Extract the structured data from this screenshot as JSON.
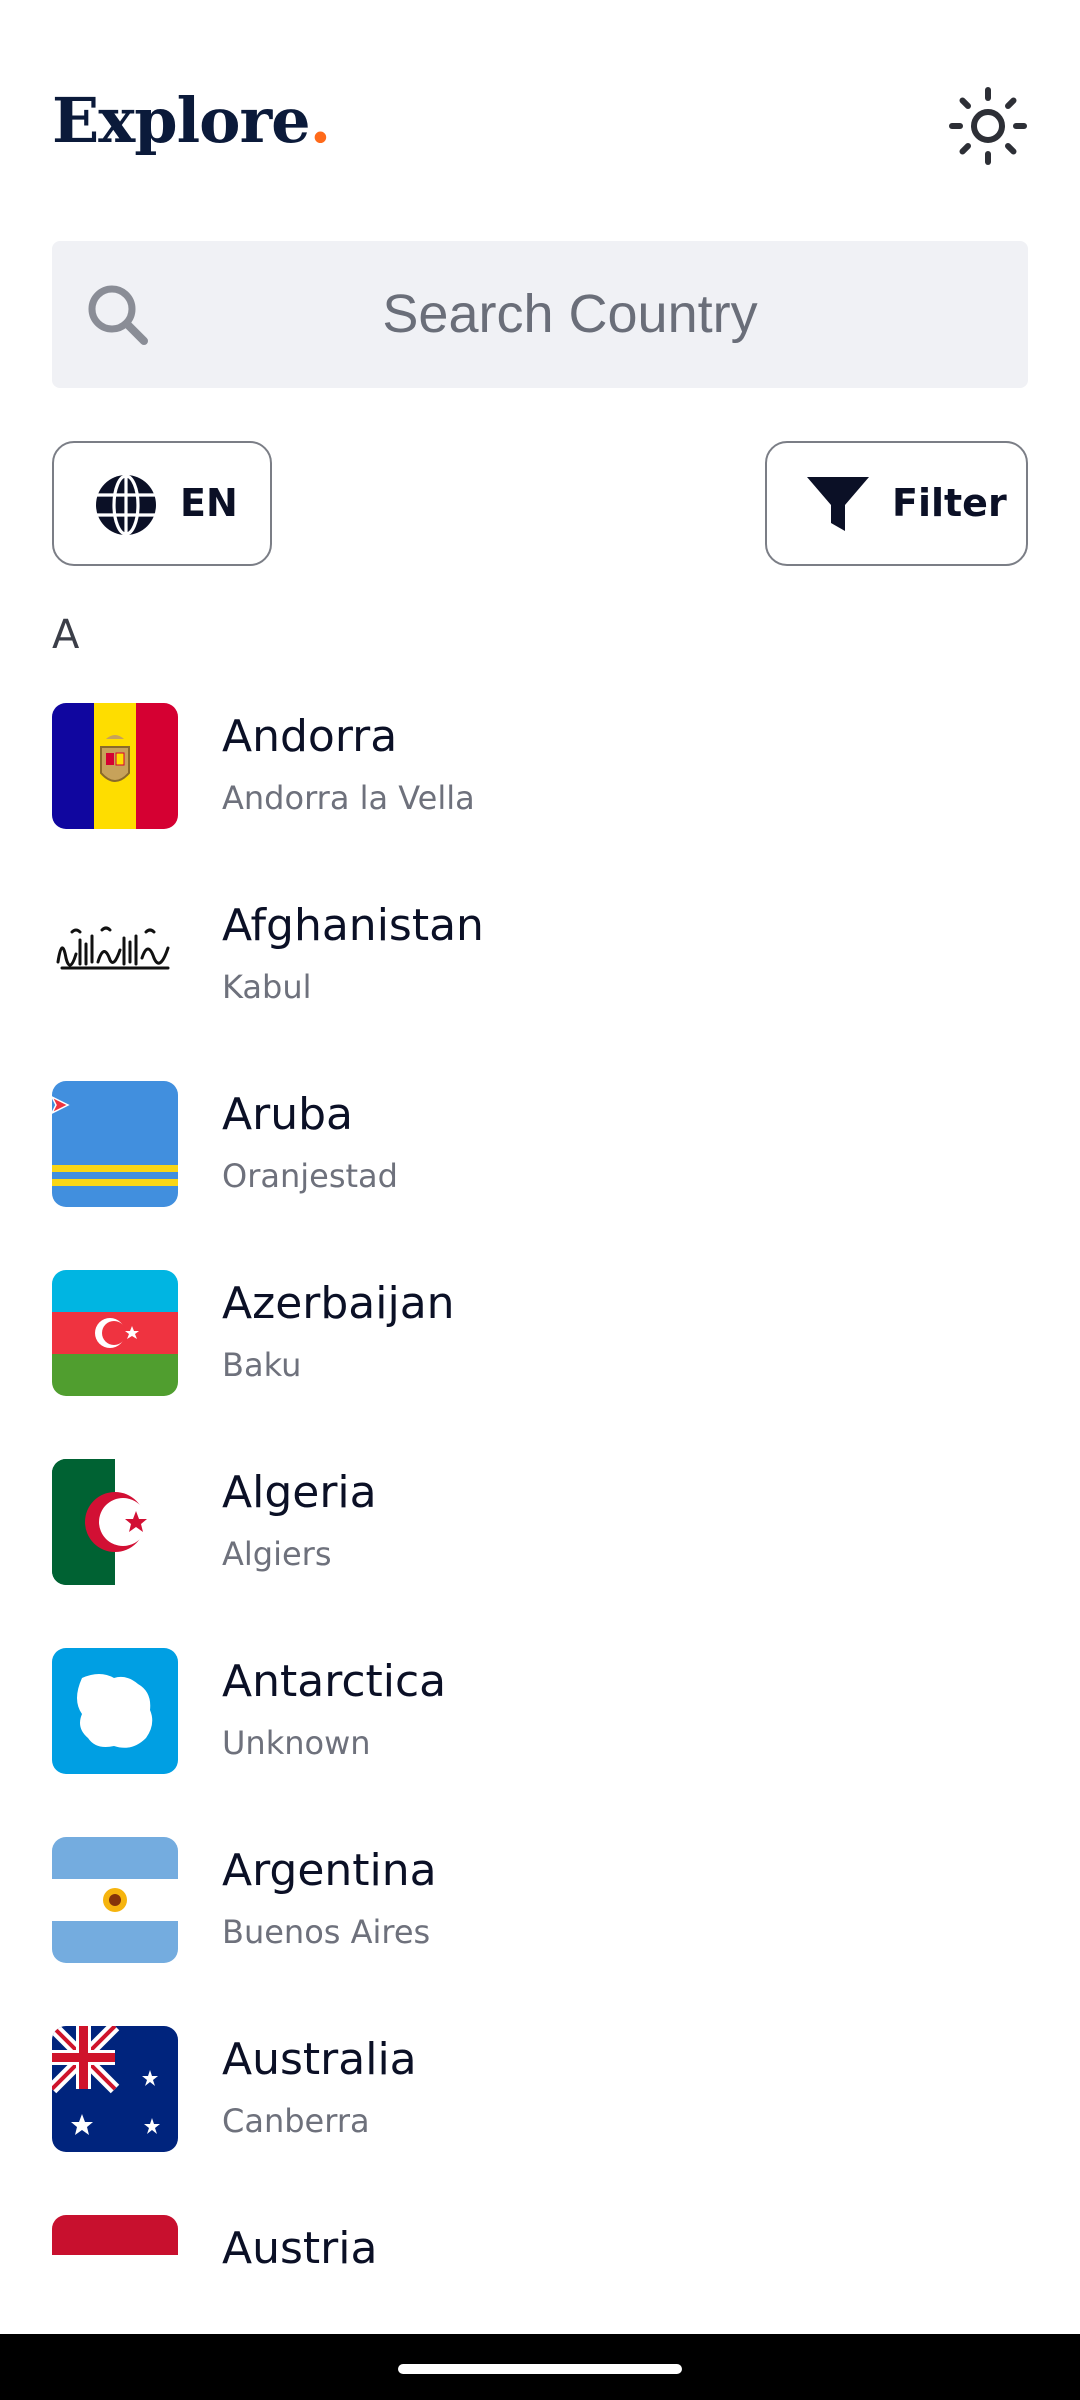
{
  "header": {
    "logo_text": "Explore",
    "logo_dot": ".",
    "theme_icon": "sun-icon"
  },
  "search": {
    "placeholder": "Search Country",
    "icon": "search-icon"
  },
  "language_button": {
    "label": "EN",
    "icon": "globe-icon"
  },
  "filter_button": {
    "label": "Filter",
    "icon": "filter-icon"
  },
  "section_letter": "A",
  "countries": [
    {
      "name": "Andorra",
      "capital": "Andorra la Vella"
    },
    {
      "name": "Afghanistan",
      "capital": "Kabul"
    },
    {
      "name": "Aruba",
      "capital": "Oranjestad"
    },
    {
      "name": "Azerbaijan",
      "capital": "Baku"
    },
    {
      "name": "Algeria",
      "capital": "Algiers"
    },
    {
      "name": "Antarctica",
      "capital": "Unknown"
    },
    {
      "name": "Argentina",
      "capital": "Buenos Aires"
    },
    {
      "name": "Australia",
      "capital": "Canberra"
    },
    {
      "name": "Austria",
      "capital": ""
    }
  ],
  "colors": {
    "accent": "#ff6a1a",
    "text": "#0b1026",
    "muted": "#6e717c",
    "search_bg": "#f0f1f5"
  }
}
